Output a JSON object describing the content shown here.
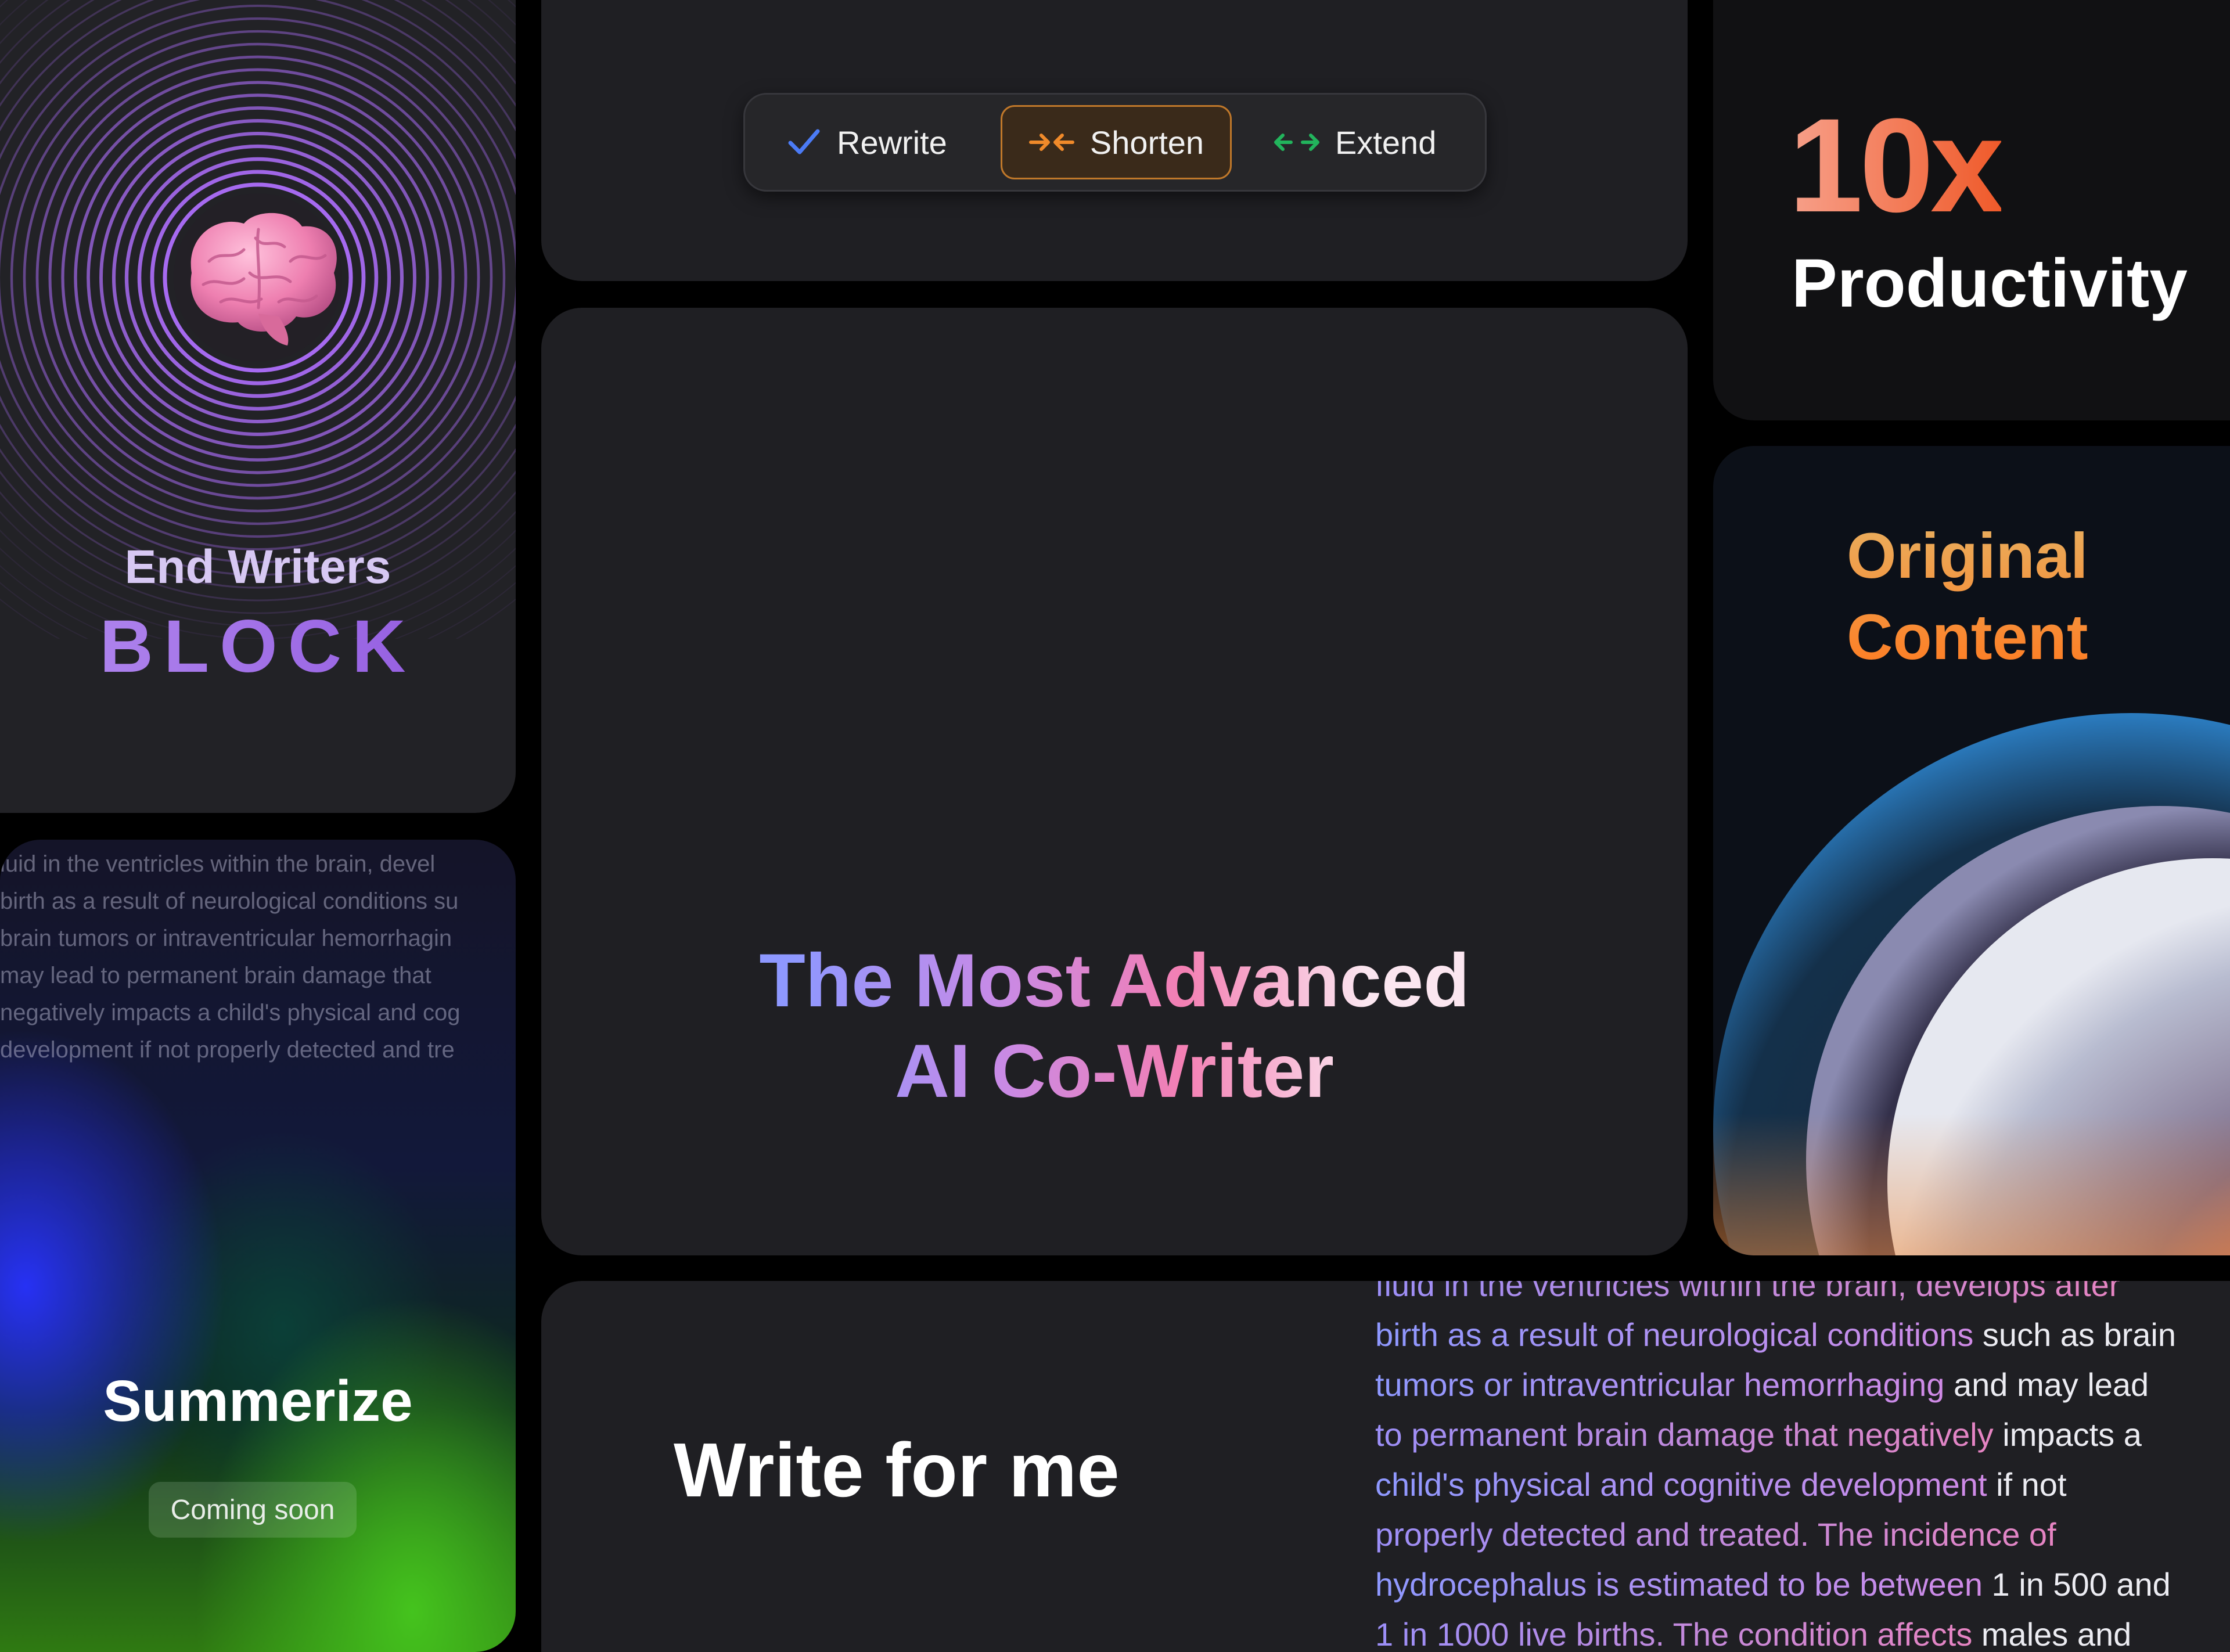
{
  "writers_block": {
    "line1": "End Writers",
    "line2": "BLOCK",
    "icon": "brain-icon",
    "accent": "#9b63e8"
  },
  "toolbar": {
    "rewrite_label": "Rewrite",
    "shorten_label": "Shorten",
    "extend_label": "Extend",
    "rewrite_color": "#4b7bf5",
    "shorten_color": "#f08a2a",
    "extend_color": "#22b45c"
  },
  "productivity": {
    "value": "10x",
    "label": "Productivity"
  },
  "original": {
    "line1": "Original",
    "line2": "Content"
  },
  "summarize": {
    "lines": [
      "luid in the ventricles within the brain, devel",
      "birth as a result of neurological conditions su",
      "brain tumors or intraventricular hemorrhagin",
      "may lead to permanent brain damage that",
      "negatively impacts a child's physical and cog",
      "development if not properly detected and tre"
    ],
    "title": "Summerize",
    "badge": "Coming soon"
  },
  "main": {
    "line1": "The Most Advanced",
    "line2": "AI Co-Writer"
  },
  "write": {
    "title": "Write for me",
    "lines": [
      [
        {
          "t": "fluid in the ventricles within the brain, develops after",
          "c": "hl-b"
        }
      ],
      [
        {
          "t": "birth as a result of neurological conditions",
          "c": "hl-a"
        },
        {
          "t": " such as brain",
          "c": ""
        }
      ],
      [
        {
          "t": "tumors or intraventricular hemorrhaging",
          "c": "hl-a"
        },
        {
          "t": " and may lead",
          "c": ""
        }
      ],
      [
        {
          "t": "to permanent brain damage that negatively",
          "c": "hl-b"
        },
        {
          "t": " impacts a",
          "c": ""
        }
      ],
      [
        {
          "t": "child's physical and cognitive development",
          "c": "hl-a"
        },
        {
          "t": " if not",
          "c": ""
        }
      ],
      [
        {
          "t": "properly detected and treated. The incidence of",
          "c": "hl-b"
        }
      ],
      [
        {
          "t": "hydrocephalus is estimated to be between",
          "c": "hl-a"
        },
        {
          "t": " 1 in 500 and",
          "c": ""
        }
      ],
      [
        {
          "t": "1 in 1000 live births. The condition affects",
          "c": "hl-b"
        },
        {
          "t": " males and",
          "c": ""
        }
      ]
    ]
  }
}
